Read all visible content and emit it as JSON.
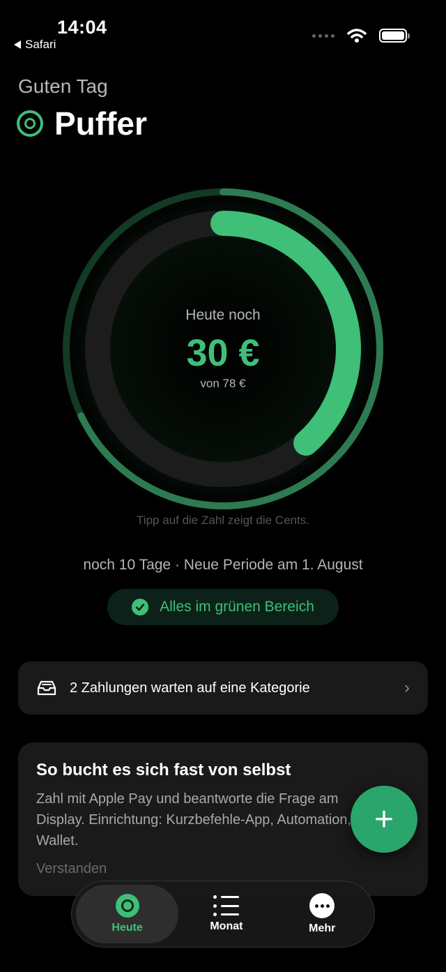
{
  "status_bar": {
    "time": "14:04",
    "back_app": "Safari"
  },
  "header": {
    "greeting": "Guten Tag",
    "app_name": "Puffer"
  },
  "budget_ring": {
    "label": "Heute noch",
    "amount": "30 €",
    "total": "von 78 €",
    "remaining_fraction": 0.385,
    "period_fraction": 0.68,
    "accent_color": "#3fbf78"
  },
  "tip": "Tipp auf die Zahl zeigt die Cents.",
  "period_info": "noch 10 Tage · Neue Periode am 1. August",
  "status_pill": {
    "label": "Alles im grünen Bereich",
    "icon": "check-circle-icon"
  },
  "pending_payments": {
    "label": "2 Zahlungen warten auf eine Kategorie",
    "icon": "tray-icon"
  },
  "info_card": {
    "title": "So bucht es sich fast von selbst",
    "body": "Zahl mit Apple Pay und beantworte die Frage am Display. Einrichtung: Kurzbefehle-App, Automation, Wallet.",
    "dismiss": "Verstanden"
  },
  "fab": {
    "label": "+"
  },
  "tabs": [
    {
      "label": "Heute",
      "icon": "target-icon",
      "active": true
    },
    {
      "label": "Monat",
      "icon": "list-icon",
      "active": false
    },
    {
      "label": "Mehr",
      "icon": "more-icon",
      "active": false
    }
  ]
}
